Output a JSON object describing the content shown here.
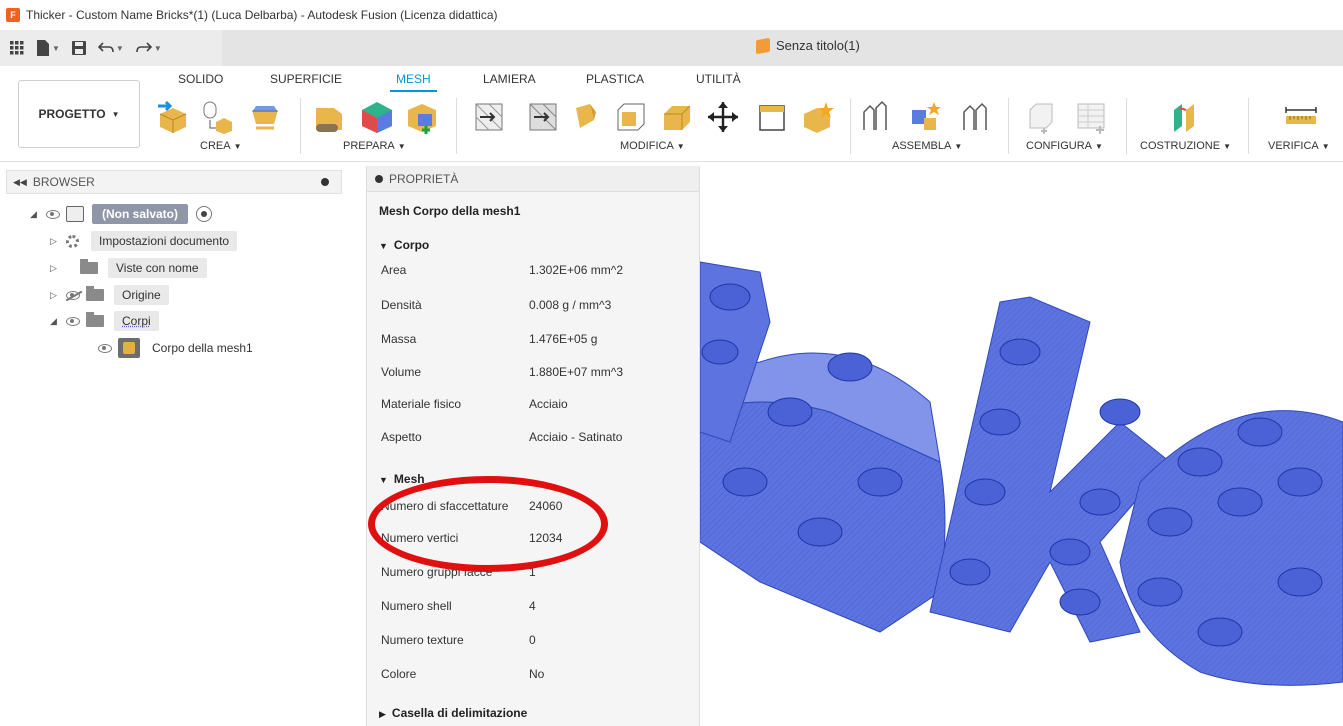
{
  "window": {
    "app_logo_letter": "F",
    "title": "Thicker - Custom Name Bricks*(1) (Luca Delbarba) - Autodesk Fusion (Licenza didattica)"
  },
  "doc_tab": {
    "title": "Senza titolo(1)"
  },
  "ribbon": {
    "tabs": [
      "SOLIDO",
      "SUPERFICIE",
      "MESH",
      "LAMIERA",
      "PLASTICA",
      "UTILITÀ"
    ],
    "active_tab": "MESH",
    "workspace_button": "PROGETTO",
    "groups": [
      "CREA",
      "PREPARA",
      "MODIFICA",
      "ASSEMBLA",
      "CONFIGURA",
      "COSTRUZIONE",
      "VERIFICA"
    ]
  },
  "browser": {
    "title": "BROWSER",
    "root_label": "(Non salvato)",
    "items": [
      {
        "label": "Impostazioni documento"
      },
      {
        "label": "Viste con nome"
      },
      {
        "label": "Origine"
      },
      {
        "label": "Corpi"
      },
      {
        "label": "Corpo della mesh1"
      }
    ]
  },
  "properties": {
    "title": "PROPRIETÀ",
    "heading": "Mesh Corpo della mesh1",
    "sections": [
      {
        "name": "Corpo",
        "rows": [
          {
            "name": "Area",
            "value": "1.302E+06 mm^2"
          },
          {
            "name": "Densità",
            "value": "0.008 g / mm^3"
          },
          {
            "name": "Massa",
            "value": "1.476E+05 g"
          },
          {
            "name": "Volume",
            "value": "1.880E+07 mm^3"
          },
          {
            "name": "Materiale fisico",
            "value": "Acciaio"
          },
          {
            "name": "Aspetto",
            "value": "Acciaio - Satinato"
          }
        ]
      },
      {
        "name": "Mesh",
        "rows": [
          {
            "name": "Numero di sfaccettature",
            "value": "24060"
          },
          {
            "name": "Numero vertici",
            "value": "12034"
          },
          {
            "name": "Numero gruppi facce",
            "value": "1"
          },
          {
            "name": "Numero shell",
            "value": "4"
          },
          {
            "name": "Numero texture",
            "value": "0"
          },
          {
            "name": "Colore",
            "value": "No"
          }
        ]
      },
      {
        "name": "Casella di delimitazione",
        "rows": []
      }
    ]
  },
  "colors": {
    "accent": "#0696d7",
    "mesh_blue": "#5d74e0",
    "annotation_red": "#e01010"
  }
}
